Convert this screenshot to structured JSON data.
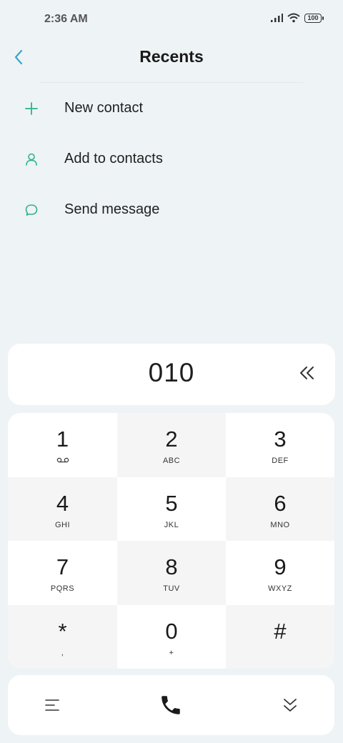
{
  "status": {
    "time": "2:36 AM",
    "battery": "100"
  },
  "header": {
    "title": "Recents"
  },
  "actions": [
    {
      "label": "New contact",
      "icon": "plus-icon"
    },
    {
      "label": "Add to contacts",
      "icon": "person-icon"
    },
    {
      "label": "Send message",
      "icon": "message-icon"
    }
  ],
  "dialer": {
    "number": "010"
  },
  "keypad": [
    {
      "digit": "1",
      "letters": "voicemail-icon"
    },
    {
      "digit": "2",
      "letters": "ABC"
    },
    {
      "digit": "3",
      "letters": "DEF"
    },
    {
      "digit": "4",
      "letters": "GHI"
    },
    {
      "digit": "5",
      "letters": "JKL"
    },
    {
      "digit": "6",
      "letters": "MNO"
    },
    {
      "digit": "7",
      "letters": "PQRS"
    },
    {
      "digit": "8",
      "letters": "TUV"
    },
    {
      "digit": "9",
      "letters": "WXYZ"
    },
    {
      "digit": "*",
      "letters": ","
    },
    {
      "digit": "0",
      "letters": "+"
    },
    {
      "digit": "#",
      "letters": ""
    }
  ],
  "colors": {
    "accent": "#2bb38b",
    "back": "#3aa5c9",
    "background": "#eef3f6"
  }
}
